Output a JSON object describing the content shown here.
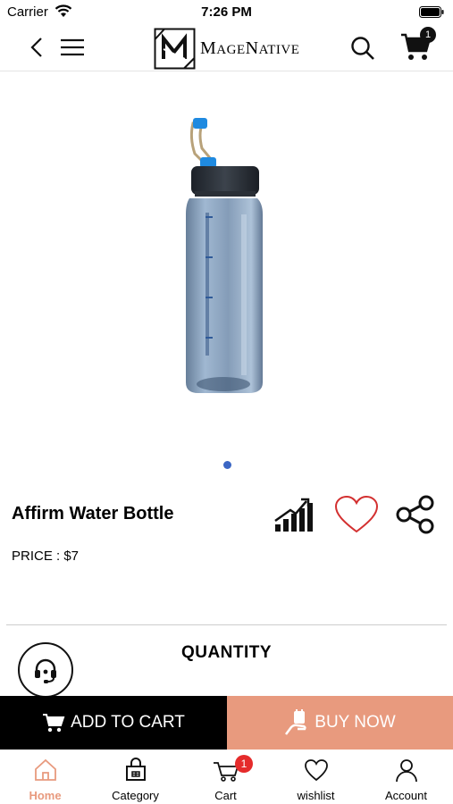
{
  "status_bar": {
    "carrier": "Carrier",
    "time": "7:26 PM"
  },
  "header": {
    "logo_text_initial_m": "M",
    "logo_text_age": "AGE",
    "logo_text_initial_n": "N",
    "logo_text_ative": "ATIVE",
    "cart_count": "1"
  },
  "product": {
    "title": "Affirm Water Bottle",
    "price": "PRICE : $7"
  },
  "quantity_label": "QUANTITY",
  "actions": {
    "add_to_cart": "ADD TO CART",
    "buy_now": "BUY NOW"
  },
  "tabs": [
    {
      "label": "Home",
      "icon": "home-icon",
      "active": true
    },
    {
      "label": "Category",
      "icon": "category-icon",
      "active": false
    },
    {
      "label": "Cart",
      "icon": "cart-icon",
      "badge": "1",
      "active": false
    },
    {
      "label": "wishlist",
      "icon": "heart-icon",
      "active": false
    },
    {
      "label": "Account",
      "icon": "account-icon",
      "active": false
    }
  ],
  "colors": {
    "accent": "#e89a7e",
    "wishlist_heart": "#d33030",
    "dot": "#3b66c4",
    "badge": "#e52b2b"
  }
}
